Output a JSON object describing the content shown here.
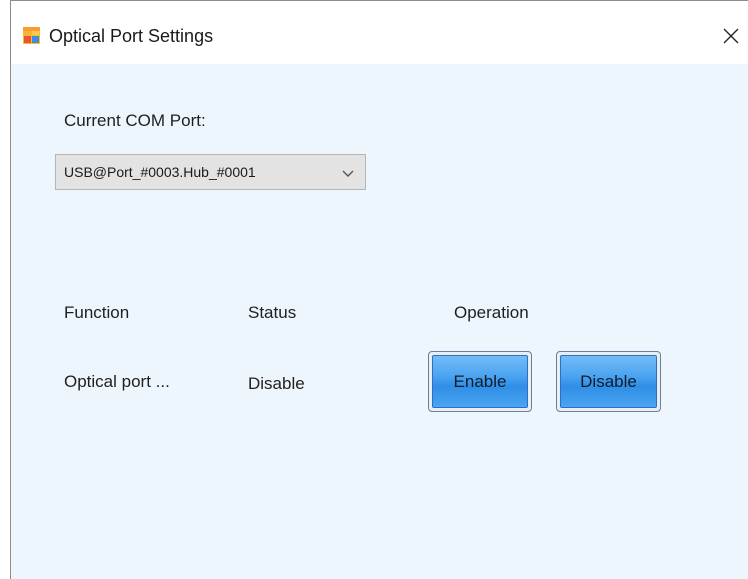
{
  "window": {
    "title": "Optical Port Settings",
    "close_symbol": "×"
  },
  "com_port": {
    "label": "Current COM Port:",
    "selected_value": "USB@Port_#0003.Hub_#0001"
  },
  "table": {
    "headers": {
      "function": "Function",
      "status": "Status",
      "operation": "Operation"
    },
    "rows": [
      {
        "function": "Optical port ...",
        "status": "Disable",
        "enable_label": "Enable",
        "disable_label": "Disable"
      }
    ]
  },
  "icons": {
    "app": "app-window-icon",
    "close": "close-icon",
    "dropdown": "chevron-down-icon"
  },
  "colors": {
    "background": "#eef6fd",
    "button_blue": "#4aa3ef"
  }
}
